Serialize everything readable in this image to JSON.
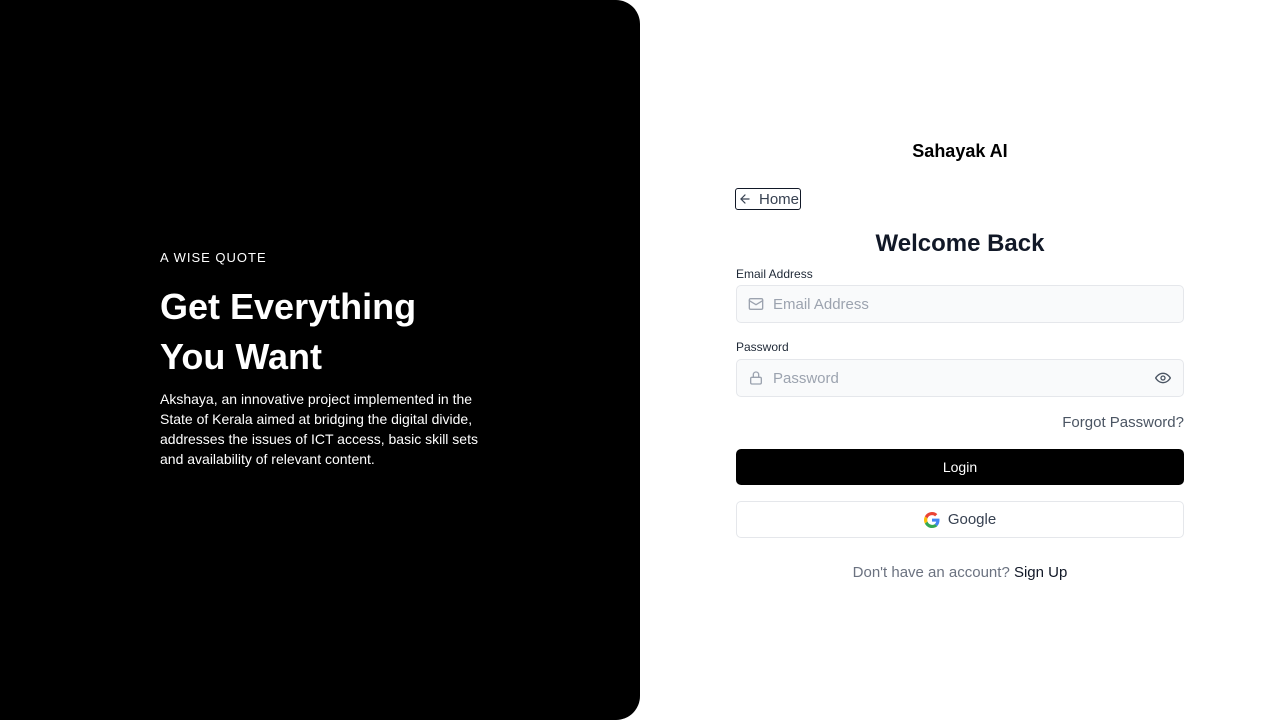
{
  "hero": {
    "quote_label": "A WISE QUOTE",
    "title_line1": "Get Everything",
    "title_line2": "You Want",
    "description": "Akshaya, an innovative project implemented in the State of Kerala aimed at bridging the digital divide, addresses the issues of ICT access, basic skill sets and availability of relevant content."
  },
  "brand": {
    "name": "Sahayak AI"
  },
  "nav": {
    "home_label": "Home",
    "home_icon": "arrow-left-icon"
  },
  "form": {
    "heading": "Welcome Back",
    "email": {
      "label": "Email Address",
      "placeholder": "Email Address",
      "value": "",
      "icon": "mail-icon"
    },
    "password": {
      "label": "Password",
      "placeholder": "Password",
      "value": "",
      "icon": "lock-icon",
      "toggle_icon": "eye-icon"
    },
    "forgot_label": "Forgot Password?",
    "login_label": "Login",
    "google_label": "Google",
    "signup_prompt": "Don't have an account?",
    "signup_label": "Sign Up"
  },
  "colors": {
    "panel_bg": "#000000",
    "primary_button": "#000000",
    "input_bg": "#f9fafb",
    "input_border": "#e5e7eb",
    "placeholder": "#9ca3af"
  }
}
